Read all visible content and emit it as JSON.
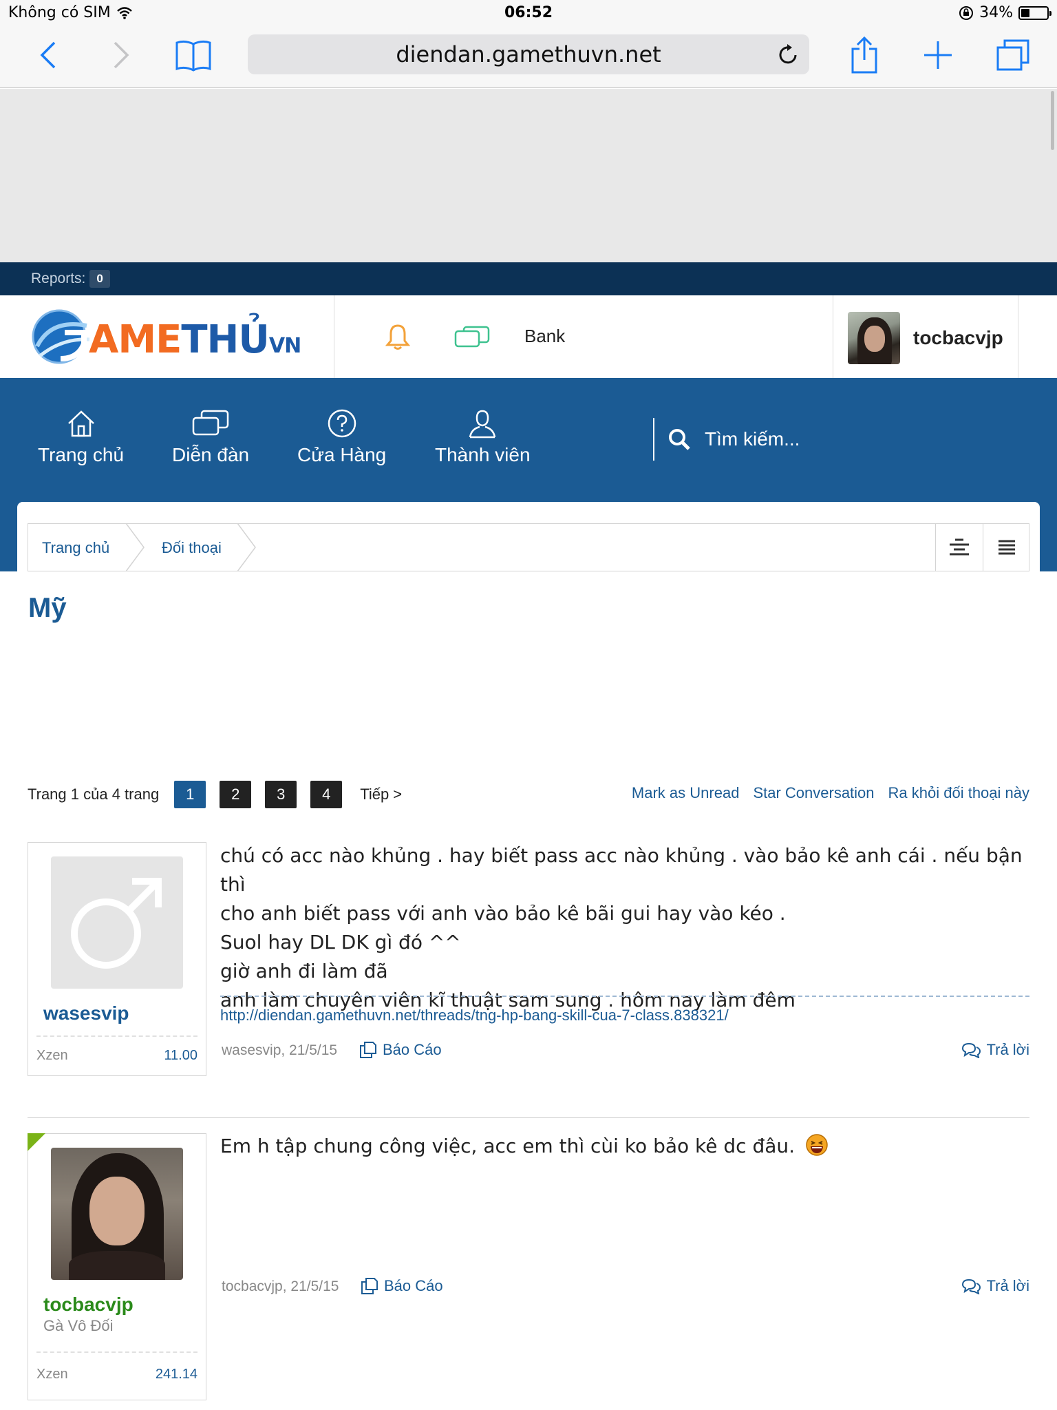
{
  "status_bar": {
    "carrier": "Không có SIM",
    "time": "06:52",
    "battery": "34%",
    "battery_level": 0.34
  },
  "browser": {
    "url": "diendan.gamethuvn.net"
  },
  "mod_bar": {
    "reports_label": "Reports:",
    "reports_count": "0"
  },
  "header": {
    "bank_label": "Bank",
    "username": "tocbacvjp"
  },
  "nav": {
    "items": [
      {
        "label": "Trang chủ",
        "icon": "home-icon"
      },
      {
        "label": "Diễn đàn",
        "icon": "chat-bubbles-icon"
      },
      {
        "label": "Cửa Hàng",
        "icon": "help-circle-icon"
      },
      {
        "label": "Thành viên",
        "icon": "user-icon"
      }
    ],
    "search_placeholder": "Tìm kiếm..."
  },
  "breadcrumb": [
    "Trang chủ",
    "Đối thoại"
  ],
  "conversation": {
    "title": "Mỹ"
  },
  "pagination": {
    "label": "Trang 1 của 4 trang",
    "pages": [
      "1",
      "2",
      "3",
      "4"
    ],
    "current": "1",
    "next": "Tiếp >"
  },
  "actions": [
    "Mark as Unread",
    "Star Conversation",
    "Ra khỏi đối thoại này"
  ],
  "messages": [
    {
      "author": "wasesvip",
      "author_title": "",
      "currency_label": "Xzen",
      "currency_value": "11.00",
      "text_lines": [
        "chú có acc nào khủng . hay biết pass acc nào khủng . vào bảo kê anh cái . nếu bận thì",
        "cho anh biết pass với anh vào bảo kê bãi gui hay vào kéo .",
        "Suol hay DL DK gì đó ^^",
        "giờ anh đi làm đã",
        "anh làm chuyên viên kĩ thuật sam sung . hôm nay làm đêm"
      ],
      "signature_link": "http://diendan.gamethuvn.net/threads/tng-hp-bang-skill-cua-7-class.838321/",
      "meta": "wasesvip, 21/5/15",
      "report_label": "Báo Cáo",
      "reply_label": "Trả lời"
    },
    {
      "author": "tocbacvjp",
      "author_title": "Gà Vô Đối",
      "currency_label": "Xzen",
      "currency_value": "241.14",
      "text_lines": [
        "Em h tập chung công việc, acc em thì cùi ko bảo kê dc đâu."
      ],
      "signature_link": "",
      "meta": "tocbacvjp, 21/5/15",
      "report_label": "Báo Cáo",
      "reply_label": "Trả lời"
    }
  ],
  "colors": {
    "brand_blue": "#1b5b94",
    "mod_bar": "#0c3155",
    "logo_orange": "#f26b21",
    "online_green": "#7ab317",
    "username_green": "#2a8a1a"
  }
}
